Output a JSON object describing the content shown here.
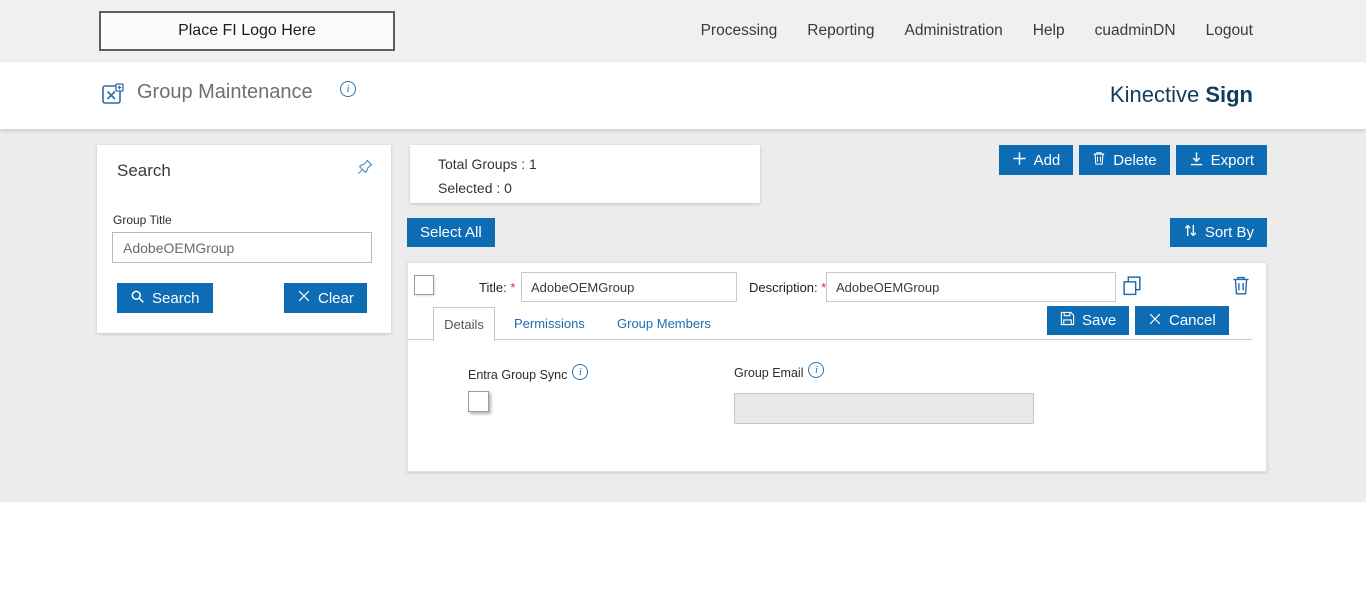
{
  "topbar": {
    "logo_text": "Place FI Logo Here",
    "nav": [
      "Processing",
      "Reporting",
      "Administration",
      "Help",
      "cuadminDN",
      "Logout"
    ]
  },
  "header": {
    "title": "Group Maintenance",
    "brand_name": "Kinective",
    "brand_suffix": "Sign"
  },
  "icons": {
    "info_glyph": "i"
  },
  "search_panel": {
    "title": "Search",
    "group_title_label": "Group Title",
    "group_title_value": "AdobeOEMGroup",
    "search_button": "Search",
    "clear_button": "Clear"
  },
  "summary": {
    "total_groups": "Total Groups : 1",
    "selected": "Selected : 0"
  },
  "toolbar": {
    "add": "Add",
    "delete": "Delete",
    "export": "Export",
    "select_all": "Select All",
    "sort_by": "Sort By"
  },
  "group_editor": {
    "title_label": "Title:",
    "required_mark": "*",
    "title_value": "AdobeOEMGroup",
    "description_label": "Description:",
    "description_value": "AdobeOEMGroup",
    "tabs": [
      "Details",
      "Permissions",
      "Group Members"
    ],
    "save_button": "Save",
    "cancel_button": "Cancel",
    "entra_group_sync_label": "Entra Group Sync",
    "group_email_label": "Group Email",
    "group_email_value": ""
  },
  "colors": {
    "accent": "#0d6cb4",
    "brand_text": "#123e5e"
  }
}
